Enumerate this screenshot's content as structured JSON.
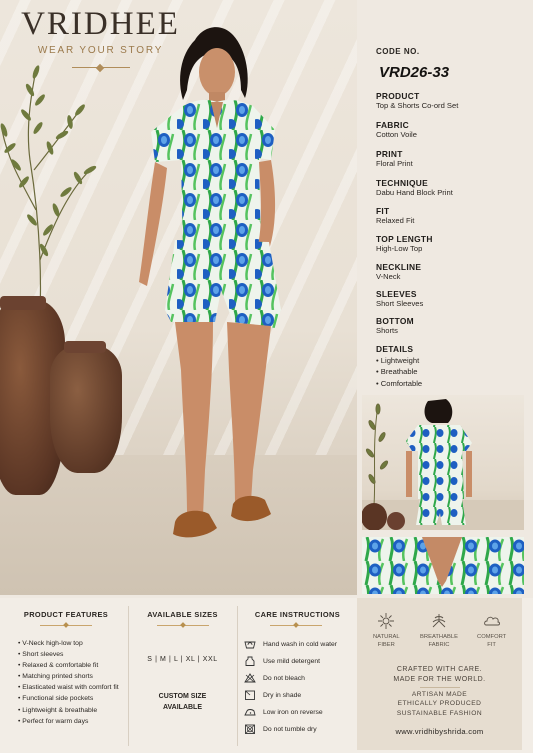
{
  "brand": {
    "name": "VRIDHEE",
    "tagline": "WEAR YOUR STORY"
  },
  "product": {
    "code_label": "CODE NO.",
    "code_value": "VRD26-33",
    "specs": [
      {
        "label": "PRODUCT",
        "value": "Top & Shorts Co-ord Set"
      },
      {
        "label": "FABRIC",
        "value": "Cotton Voile"
      },
      {
        "label": "PRINT",
        "value": "Floral Print"
      },
      {
        "label": "TECHNIQUE",
        "value": "Dabu Hand Block Print"
      },
      {
        "label": "FIT",
        "value": "Relaxed Fit"
      },
      {
        "label": "TOP LENGTH",
        "value": "High-Low Top"
      },
      {
        "label": "NECKLINE",
        "value": "V-Neck"
      },
      {
        "label": "SLEEVES",
        "value": "Short Sleeves"
      },
      {
        "label": "BOTTOM",
        "value": "Shorts"
      }
    ],
    "details_label": "DETAILS",
    "details": [
      "Lightweight",
      "Breathable",
      "Comfortable"
    ]
  },
  "features": {
    "title": "PRODUCT FEATURES",
    "items": [
      "V-Neck high-low top",
      "Short sleeves",
      "Relaxed & comfortable fit",
      "Matching printed shorts",
      "Elasticated waist with comfort fit",
      "Functional side pockets",
      "Lightweight & breathable",
      "Perfect for warm days"
    ]
  },
  "sizes": {
    "title": "AVAILABLE SIZES",
    "list": "S  |  M  |  L  |  XL  |  XXL",
    "custom_line1": "CUSTOM SIZE",
    "custom_line2": "AVAILABLE"
  },
  "care": {
    "title": "CARE INSTRUCTIONS",
    "items": [
      {
        "icon": "hand-wash-icon",
        "text": "Hand wash in cold water"
      },
      {
        "icon": "mild-detergent-icon",
        "text": "Use mild detergent"
      },
      {
        "icon": "no-bleach-icon",
        "text": "Do not bleach"
      },
      {
        "icon": "dry-in-shade-icon",
        "text": "Dry in shade"
      },
      {
        "icon": "low-iron-icon",
        "text": "Low iron on reverse"
      },
      {
        "icon": "no-tumble-dry-icon",
        "text": "Do not tumble dry"
      }
    ]
  },
  "brand_panel": {
    "badges": [
      {
        "icon": "natural-fiber-icon",
        "line1": "NATURAL",
        "line2": "FIBER"
      },
      {
        "icon": "breathable-fabric-icon",
        "line1": "BREATHABLE",
        "line2": "FABRIC"
      },
      {
        "icon": "comfort-fit-icon",
        "line1": "COMFORT",
        "line2": "FIT"
      }
    ],
    "crafted_line1": "CRAFTED WITH CARE.",
    "crafted_line2": "MADE FOR THE WORLD.",
    "artisan_line1": "ARTISAN MADE",
    "artisan_line2": "ETHICALLY PRODUCED",
    "artisan_line3": "SUSTAINABLE FASHION",
    "url": "www.vridhibyshrida.com"
  },
  "colors": {
    "print_green": "#35b34a",
    "print_blue": "#1e5fc2",
    "accent_gold": "#b08d5a",
    "terracotta": "#5a3524"
  }
}
